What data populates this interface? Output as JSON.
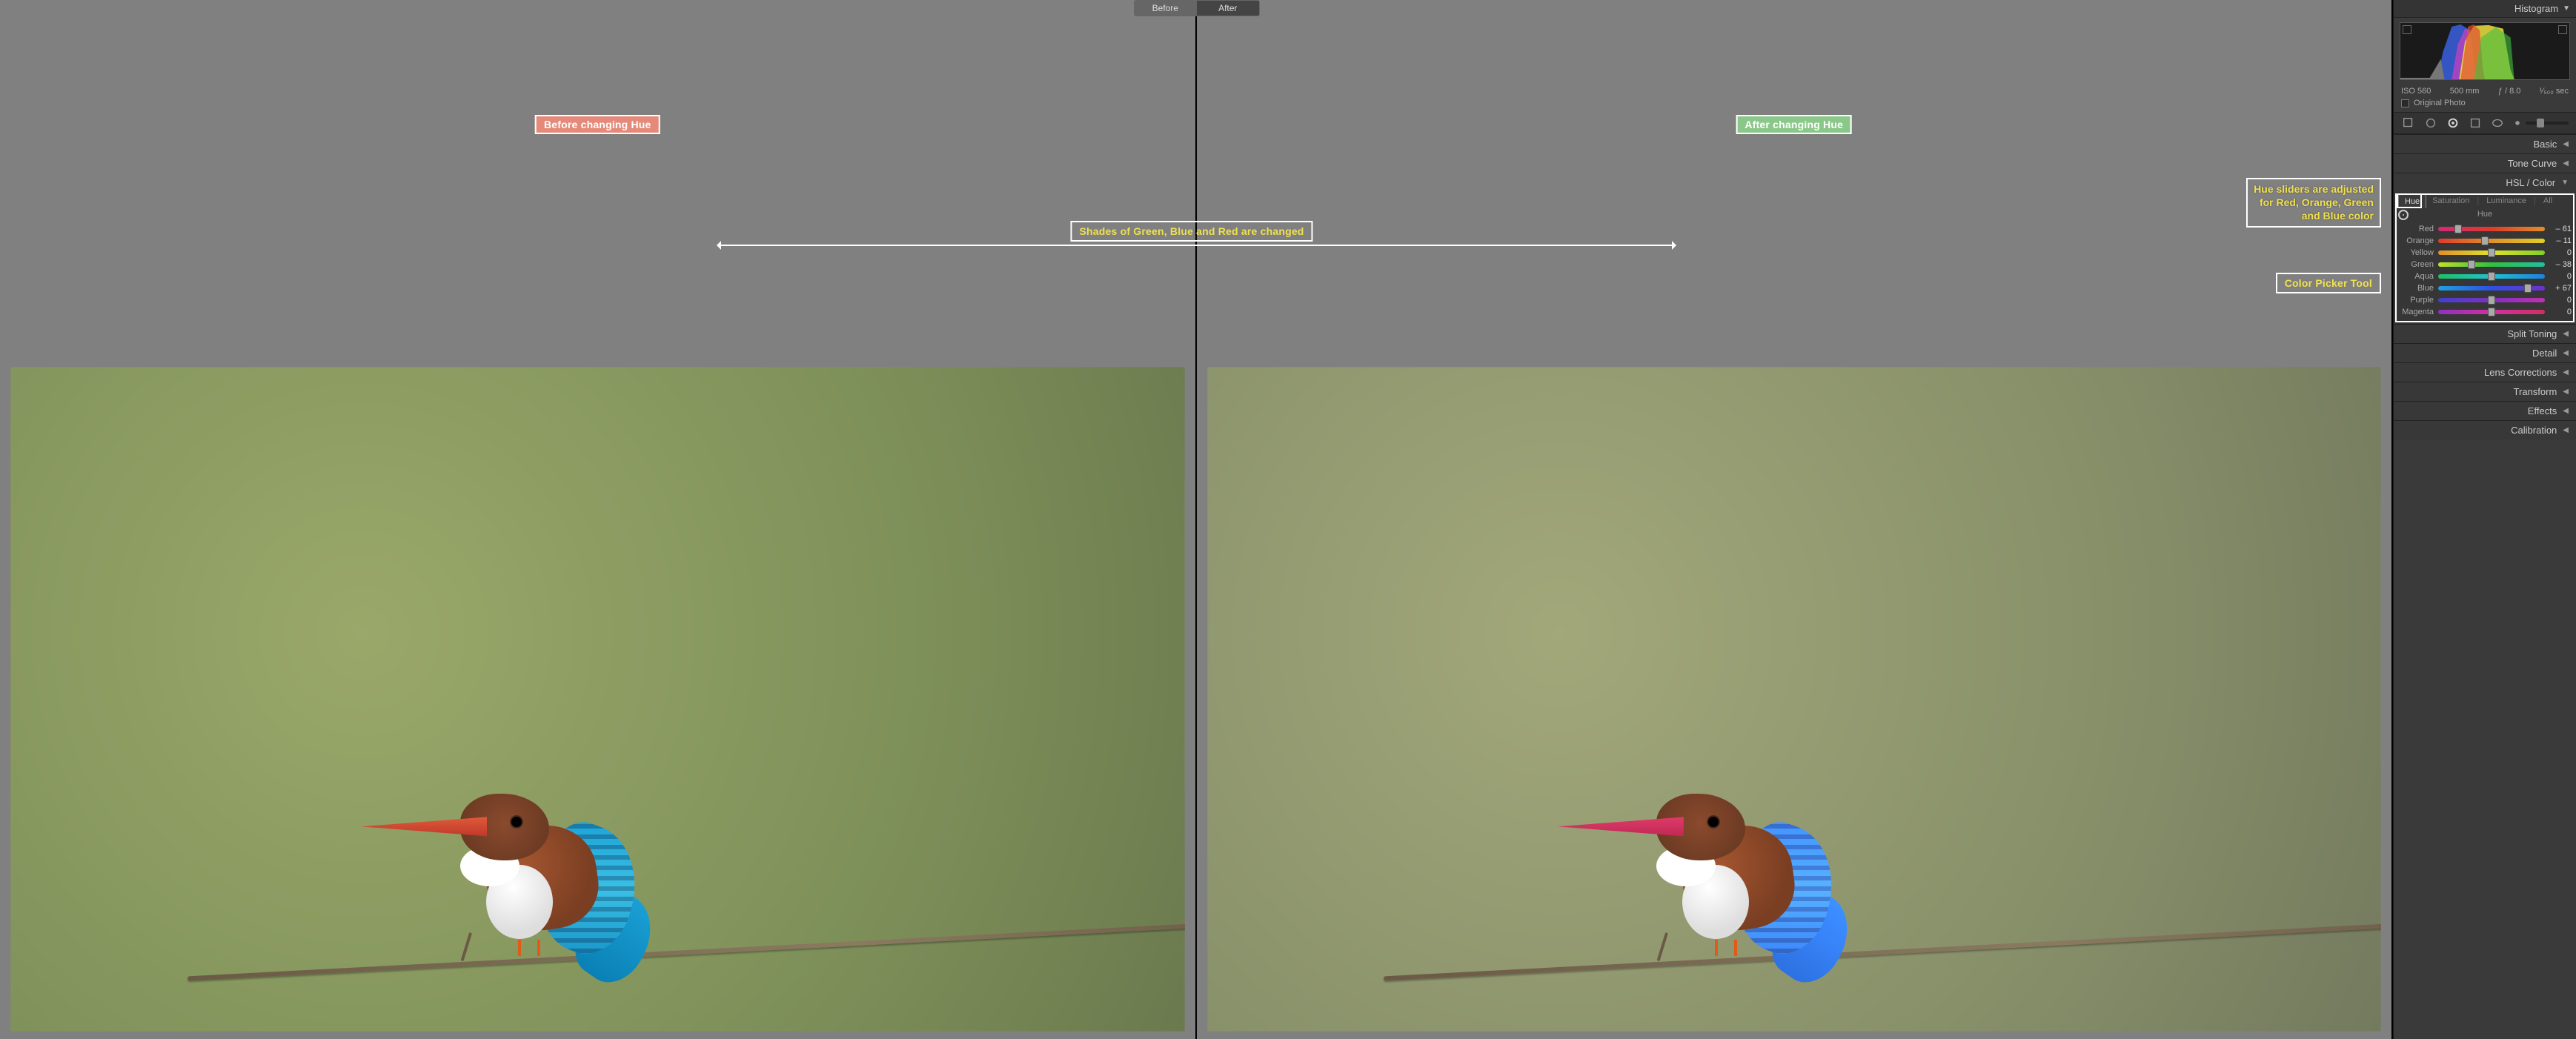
{
  "compare": {
    "before_label": "Before",
    "after_label": "After"
  },
  "annotations": {
    "before_chip": "Before changing Hue",
    "after_chip": "After changing Hue",
    "shades_changed": "Shades of Green, Blue and Red are changed",
    "hue_sliders_note_l1": "Hue sliders are adjusted",
    "hue_sliders_note_l2": "for Red, Orange, Green",
    "hue_sliders_note_l3": "and Blue color",
    "color_picker_label": "Color Picker Tool"
  },
  "panel": {
    "histogram_title": "Histogram",
    "metadata": {
      "iso": "ISO 560",
      "focal": "500 mm",
      "aperture": "ƒ / 8.0",
      "shutter": "¹⁄₅₀₀ sec"
    },
    "original_photo_label": "Original Photo",
    "sections": {
      "basic": "Basic",
      "tone_curve": "Tone Curve",
      "hsl_color": "HSL / Color",
      "split_toning": "Split Toning",
      "detail": "Detail",
      "lens_corrections": "Lens Corrections",
      "transform": "Transform",
      "effects": "Effects",
      "calibration": "Calibration"
    },
    "hsl": {
      "tabs": {
        "hue": "Hue",
        "saturation": "Saturation",
        "luminance": "Luminance",
        "all": "All"
      },
      "sub_title": "Hue",
      "sliders": [
        {
          "label": "Red",
          "value": "– 61",
          "pos": 19,
          "grad": "g-red"
        },
        {
          "label": "Orange",
          "value": "– 11",
          "pos": 44,
          "grad": "g-orange"
        },
        {
          "label": "Yellow",
          "value": "0",
          "pos": 50,
          "grad": "g-yellow"
        },
        {
          "label": "Green",
          "value": "– 38",
          "pos": 31,
          "grad": "g-green"
        },
        {
          "label": "Aqua",
          "value": "0",
          "pos": 50,
          "grad": "g-aqua"
        },
        {
          "label": "Blue",
          "value": "+ 67",
          "pos": 84,
          "grad": "g-blue"
        },
        {
          "label": "Purple",
          "value": "0",
          "pos": 50,
          "grad": "g-purple"
        },
        {
          "label": "Magenta",
          "value": "0",
          "pos": 50,
          "grad": "g-magenta"
        }
      ]
    }
  }
}
